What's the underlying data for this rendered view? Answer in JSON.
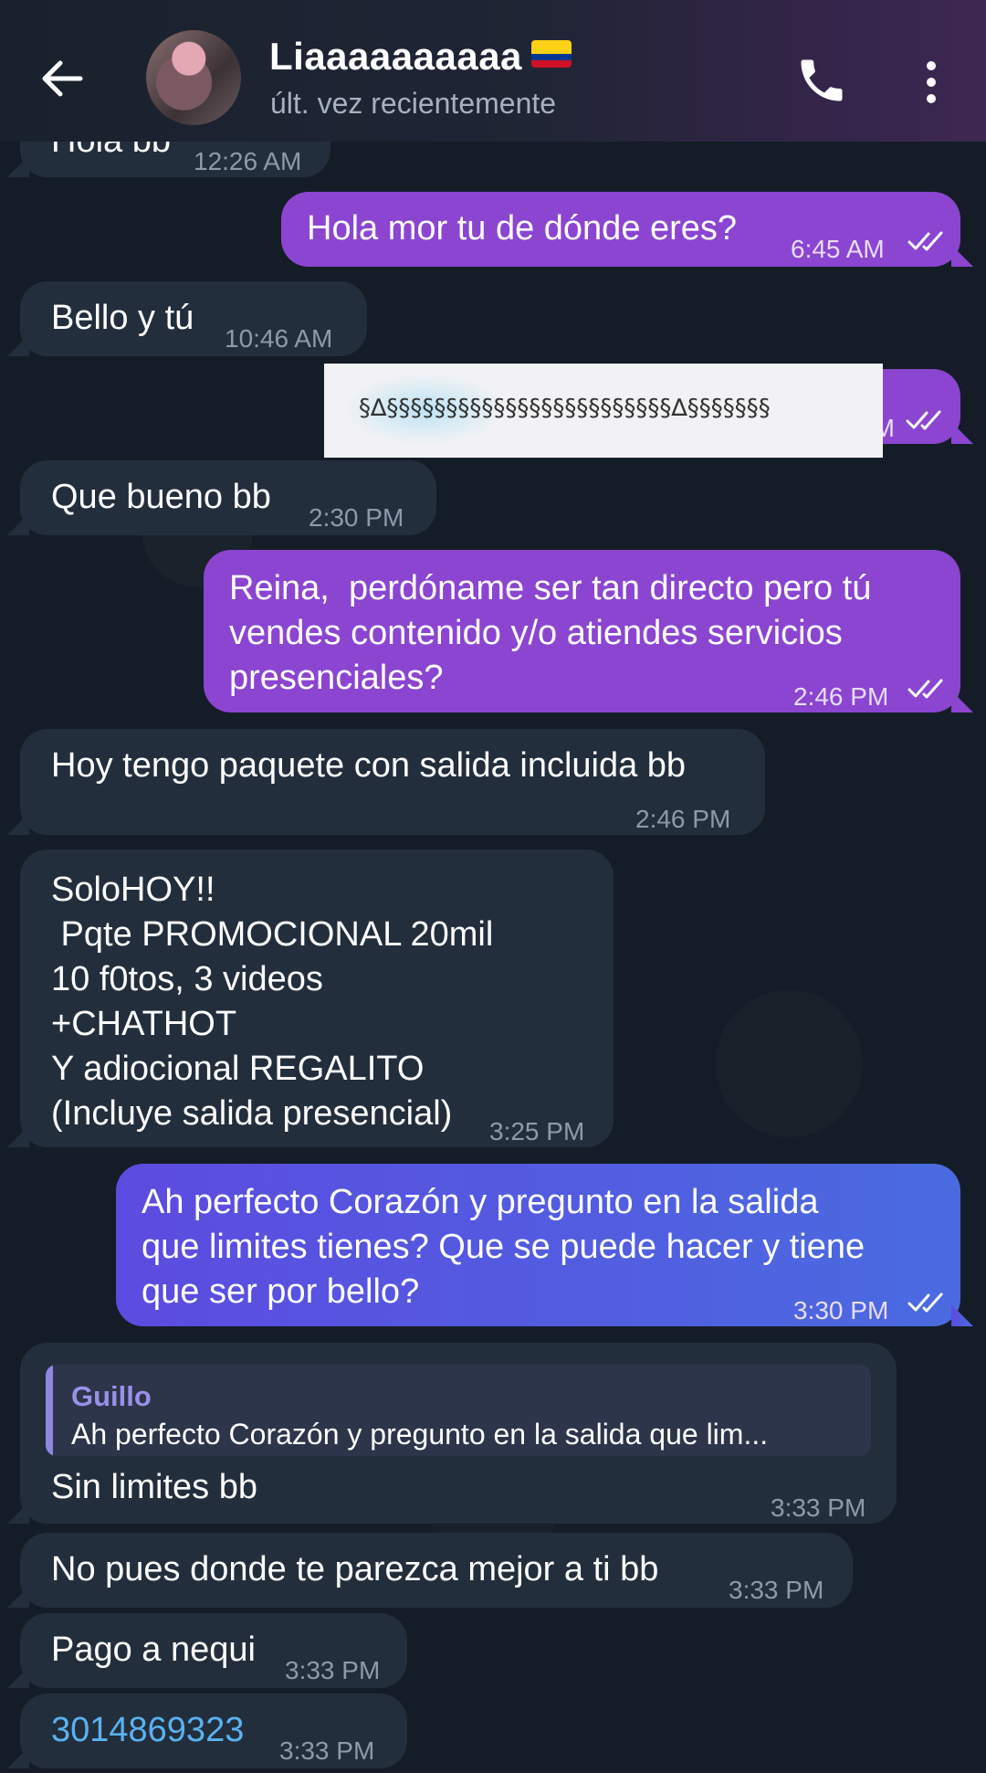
{
  "header": {
    "contact_name": "Liaaaaaaaaaa",
    "flag_icon": "colombia-flag-icon",
    "status": "últ. vez recientemente"
  },
  "colors": {
    "outgoing": "#8b45d1",
    "incoming": "#232e3c",
    "header_accent": "#3d2852",
    "link": "#5ab2f0"
  },
  "messages": [
    {
      "dir": "in",
      "text": "Hola bb",
      "time": "12:26 AM"
    },
    {
      "dir": "out",
      "text": "Hola mor tu de dónde eres?",
      "time": "6:45 AM",
      "read": true
    },
    {
      "dir": "in",
      "text": "Bello y tú",
      "time": "10:46 AM"
    },
    {
      "dir": "out",
      "text": "",
      "time": "PM",
      "read": true,
      "redaction_text": "§∆§§§§§§§§§§§§§§§§§§§§§§§§∆§§§§§§§"
    },
    {
      "dir": "in",
      "text": "Que bueno bb",
      "time": "2:30 PM"
    },
    {
      "dir": "out",
      "lines": [
        "Reina,  perdóname ser tan directo pero tú",
        "vendes contenido y/o atiendes servicios",
        "presenciales?"
      ],
      "time": "2:46 PM",
      "read": true
    },
    {
      "dir": "in",
      "text": "Hoy tengo paquete con salida incluida bb",
      "time": "2:46 PM"
    },
    {
      "dir": "in",
      "lines": [
        "SoloHOY!!",
        " Pqte PROMOCIONAL 20mil",
        "10 f0tos, 3 videos",
        "+CHATHOT",
        "Y adiocional REGALITO",
        "(Incluye salida presencial)"
      ],
      "time": "3:25 PM"
    },
    {
      "dir": "out",
      "lines": [
        "Ah perfecto Corazón y pregunto en la salida",
        "que limites tienes? Que se puede hacer y tiene",
        "que ser por bello?"
      ],
      "time": "3:30 PM",
      "read": true
    },
    {
      "dir": "in",
      "reply_name": "Guillo",
      "reply_text": "Ah perfecto Corazón y pregunto en la salida que lim...",
      "text": "Sin limites bb",
      "time": "3:33 PM"
    },
    {
      "dir": "in",
      "text": "No pues donde te parezca mejor a ti bb",
      "time": "3:33 PM"
    },
    {
      "dir": "in",
      "text": "Pago a nequi",
      "time": "3:33 PM"
    },
    {
      "dir": "in",
      "text": "3014869323",
      "time": "3:33 PM",
      "is_link": true
    }
  ]
}
